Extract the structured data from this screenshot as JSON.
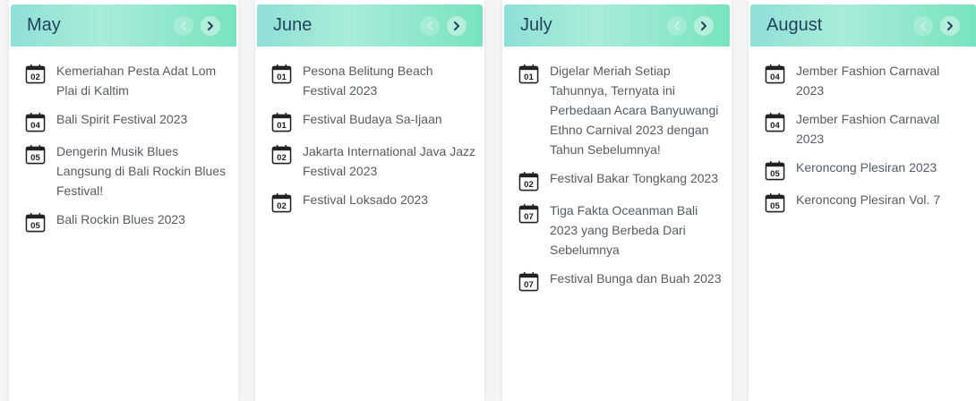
{
  "months": [
    {
      "name": "May",
      "events": [
        {
          "day": "02",
          "title": "Kemeriahan Pesta Adat Lom Plai di Kaltim"
        },
        {
          "day": "04",
          "title": "Bali Spirit Festival 2023"
        },
        {
          "day": "05",
          "title": "Dengerin Musik Blues Langsung di Bali Rockin Blues Festival!"
        },
        {
          "day": "05",
          "title": "Bali Rockin Blues 2023"
        }
      ]
    },
    {
      "name": "June",
      "events": [
        {
          "day": "01",
          "title": "Pesona Belitung Beach Festival 2023"
        },
        {
          "day": "01",
          "title": "Festival Budaya Sa-Ijaan"
        },
        {
          "day": "02",
          "title": "Jakarta International Java Jazz Festival 2023"
        },
        {
          "day": "02",
          "title": "Festival Loksado 2023"
        }
      ]
    },
    {
      "name": "July",
      "events": [
        {
          "day": "01",
          "title": "Digelar Meriah Setiap Tahunnya, Ternyata ini Perbedaan Acara Banyuwangi Ethno Carnival 2023 dengan Tahun Sebelumnya!"
        },
        {
          "day": "02",
          "title": "Festival Bakar Tongkang 2023"
        },
        {
          "day": "07",
          "title": "Tiga Fakta Oceanman Bali 2023 yang Berbeda Dari Sebelumnya"
        },
        {
          "day": "07",
          "title": "Festival Bunga dan Buah 2023"
        }
      ]
    },
    {
      "name": "August",
      "events": [
        {
          "day": "04",
          "title": "Jember Fashion Carnaval 2023"
        },
        {
          "day": "04",
          "title": "Jember Fashion Carnaval 2023"
        },
        {
          "day": "05",
          "title": "Keroncong Plesiran 2023"
        },
        {
          "day": "05",
          "title": "Keroncong Plesiran Vol. 7"
        }
      ]
    }
  ],
  "icons": {
    "prev": "chevron-left-icon",
    "next": "chevron-right-icon",
    "date": "calendar-icon"
  },
  "colors": {
    "header_gradient_start": "#8fe0d7",
    "header_gradient_end": "#78e3c0",
    "title_text": "#23425c",
    "event_text": "#555c63"
  }
}
